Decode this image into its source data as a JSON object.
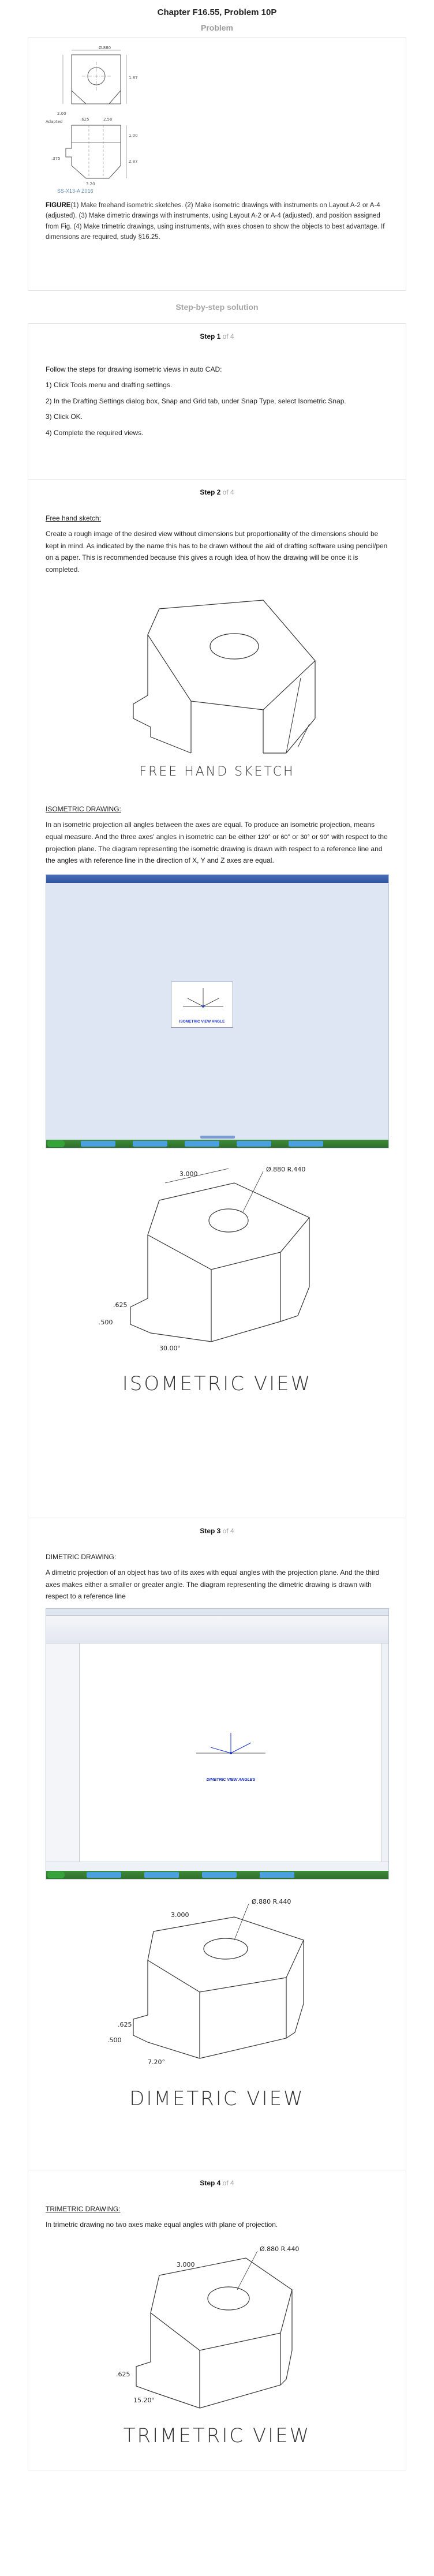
{
  "header": {
    "title": "Chapter F16.55, Problem 10P",
    "problem_label": "Problem"
  },
  "problem": {
    "caption_bold": "FIGURE",
    "caption_rest": "(1) Make freehand isometric sketches. (2) Make isometric drawings with instruments on Layout A-2 or A-4 (adjusted). (3) Make dimetric drawings with instruments, using Layout A-2 or A-4 (adjusted), and position assigned from Fig. (4) Make trimetric drawings, using instruments, with axes chosen to show the objects to best advantage. If dimensions are required, study §16.25.",
    "figure_labels": [
      "Ø.880",
      "1.87",
      "2.00",
      "Adapted",
      ".625",
      "2.50",
      "1.00",
      ".375",
      "2.87",
      "3.20"
    ],
    "figure_caption": "SS-X13-A Z016"
  },
  "solution_label": "Step-by-step solution",
  "steps": [
    {
      "label": "Step 1",
      "of": "of 4",
      "lines": [
        "Follow the steps for drawing isometric views in auto CAD:",
        "1) Click Tools menu and drafting settings.",
        "2) In the Drafting Settings dialog box, Snap and Grid tab, under Snap Type, select Isometric Snap.",
        "3) Click OK.",
        "4) Complete the required views."
      ]
    },
    {
      "label": "Step 2",
      "of": "of 4",
      "heading1": "Free hand sketch:",
      "para1": "Create a rough image of the desired view without dimensions but proportionality of the dimensions should be kept in mind. As indicated by the name this has to be drawn without the aid of drafting software using pencil/pen on a paper. This is recommended because this gives a rough idea of how the drawing will be once it is completed.",
      "sketch_label": "FREE HAND SKETCH",
      "heading2": "ISOMETRIC DRAWING:",
      "para2_a": "In an isometric projection all angles between the axes are equal. To produce an isometric projection, means equal measure. And the three axes' angles in isometric can be either",
      "angle1": "120°",
      "para2_or1": "or",
      "angle2": "60°",
      "para2_or2": "or",
      "angle3": "30°",
      "para2_or3": "or",
      "angle4": "90°",
      "para2_b": "with respect to the projection plane. The diagram representing the isometric drawing is drawn with respect to a reference line and the angles with reference line in the direction of X, Y and Z axes are equal.",
      "screenshot_title": "Isometric view angle",
      "iso_dims": [
        "3.000",
        "Ø.880 R.440",
        ".625",
        ".500",
        "30.00°"
      ],
      "iso_label": "ISOMETRIC VIEW"
    },
    {
      "label": "Step 3",
      "of": "of 4",
      "heading": "DIMETRIC DRAWING:",
      "para": "A dimetric projection of an object has two of its axes with equal angles with the projection plane. And the third axes makes either a smaller or greater angle. The diagram representing the dimetric drawing is drawn with respect to a reference line",
      "screenshot_title": "DIMETRIC VIEW ANGLES",
      "dim_dims": [
        "3.000",
        "Ø.880 R.440",
        ".625",
        ".500",
        "7.20°"
      ],
      "dim_label": "DIMETRIC VIEW"
    },
    {
      "label": "Step 4",
      "of": "of 4",
      "heading": "TRIMETRIC DRAWING:",
      "para": "In trimetric drawing no two axes make equal angles with plane of projection.",
      "tri_dims": [
        "3.000",
        "Ø.880 R.440",
        ".625",
        "15.20°"
      ],
      "tri_label": "TRIMETRIC VIEW"
    }
  ]
}
